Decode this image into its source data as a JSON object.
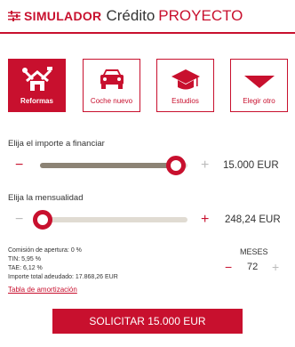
{
  "header": {
    "brand": "SIMULADOR",
    "product": "Crédito",
    "title": "PROYECTO"
  },
  "tiles": [
    {
      "label": "Reformas",
      "icon": "house-tools-icon",
      "active": true
    },
    {
      "label": "Coche nuevo",
      "icon": "car-icon",
      "active": false
    },
    {
      "label": "Estudios",
      "icon": "graduation-cap-icon",
      "active": false
    },
    {
      "label": "Elegir otro",
      "icon": "dropdown-triangle-icon",
      "active": false
    }
  ],
  "amount": {
    "label": "Elija el importe a financiar",
    "value": "15.000 EUR",
    "minus": "−",
    "plus": "+",
    "position": 0.92
  },
  "installment": {
    "label": "Elija la mensualidad",
    "value": "248,24 EUR",
    "minus": "−",
    "plus": "+",
    "position": 0.02
  },
  "info": {
    "commission": "Comisión de apertura: 0 %",
    "tin": "TIN: 5,95 %",
    "tae": "TAE: 6,12 %",
    "total": "Importe total adeudado: 17.868,26 EUR",
    "table_link": "Tabla de amortización"
  },
  "months": {
    "label": "MESES",
    "value": "72",
    "minus": "−",
    "plus": "+"
  },
  "cta": {
    "label": "SOLICITAR 15.000 EUR"
  },
  "colors": {
    "accent": "#c8102e",
    "track": "#e0dbd2",
    "fill": "#8c8375"
  }
}
